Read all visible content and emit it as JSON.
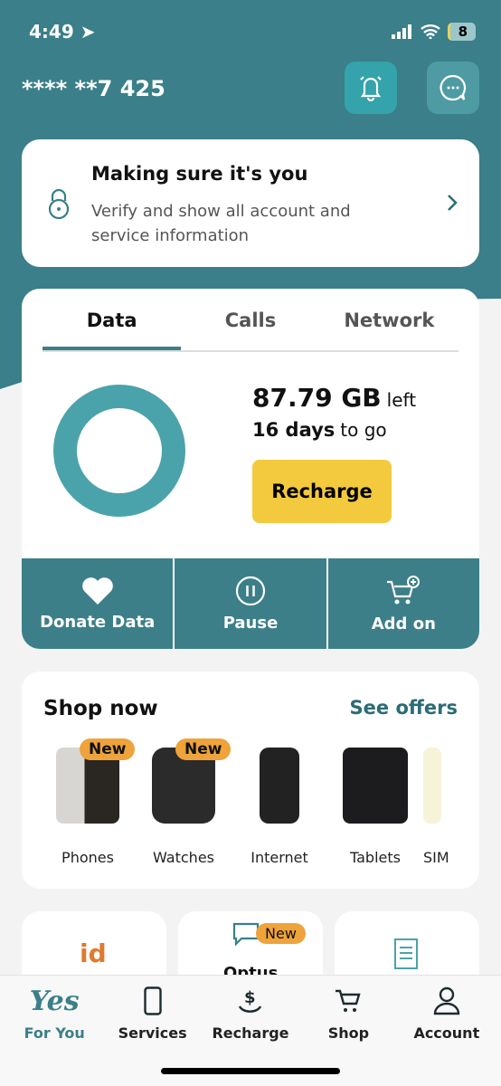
{
  "status": {
    "time": "4:49",
    "battery": "8"
  },
  "header": {
    "account": "**** **7 425"
  },
  "verify": {
    "title": "Making sure it's you",
    "text": "Verify and show all account and service information"
  },
  "usage": {
    "tabs": [
      "Data",
      "Calls",
      "Network"
    ],
    "active_tab": "Data",
    "amount": "87.79 GB",
    "amount_suffix": "left",
    "days": "16 days",
    "days_suffix": "to go",
    "recharge": "Recharge",
    "remaining_fraction": 1.0
  },
  "actions": [
    {
      "label": "Donate Data",
      "icon": "heart-icon"
    },
    {
      "label": "Pause",
      "icon": "pause-icon"
    },
    {
      "label": "Add on",
      "icon": "cart-plus-icon"
    }
  ],
  "shop": {
    "title": "Shop now",
    "see_offers": "See offers",
    "items": [
      {
        "label": "Phones",
        "badge": "New"
      },
      {
        "label": "Watches",
        "badge": "New"
      },
      {
        "label": "Internet"
      },
      {
        "label": "Tablets"
      },
      {
        "label": "SIM"
      }
    ]
  },
  "tiles": {
    "badge": "New",
    "partial": "Optus"
  },
  "nav": [
    {
      "label": "For You",
      "logo": "Yes"
    },
    {
      "label": "Services"
    },
    {
      "label": "Recharge"
    },
    {
      "label": "Shop"
    },
    {
      "label": "Account"
    }
  ],
  "colors": {
    "brand": "#3a7f89",
    "donut": "#4aa3ab",
    "recharge": "#f3ca3e",
    "badge": "#efa33b"
  }
}
